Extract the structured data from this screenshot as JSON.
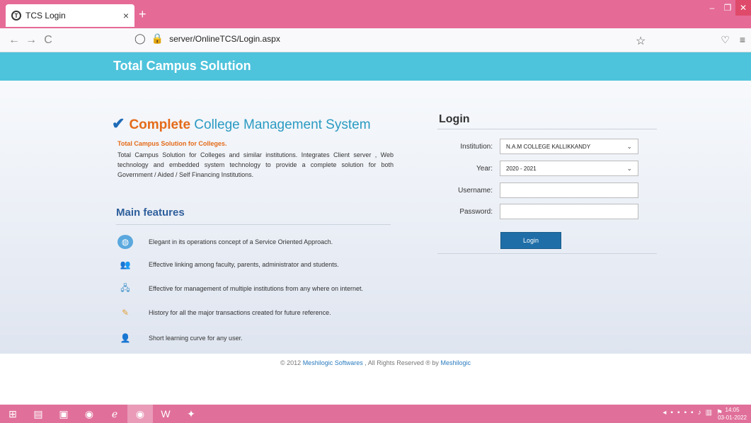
{
  "browser": {
    "tab_title": "TCS Login",
    "tab_close": "×",
    "new_tab": "+",
    "url": "server/OnlineTCS/Login.aspx",
    "back": "←",
    "forward": "→",
    "reload": "C"
  },
  "banner": {
    "title": "Total Campus Solution"
  },
  "intro": {
    "title_bold": "Complete",
    "title_rest": "College Management System",
    "sub_heading": "Total Campus Solution for Colleges.",
    "description": "Total Campus Solution for Colleges and similar institutions. Integrates Client server , Web technology and embedded system technology to provide a complete solution for both Government / Aided / Self Financing Institutions."
  },
  "features": {
    "title": "Main features",
    "items": [
      {
        "text": "Elegant in its operations concept of a Service Oriented Approach.",
        "icon": "globe-icon",
        "color": "#5aa8de"
      },
      {
        "text": "Effective linking among faculty, parents, administrator and students.",
        "icon": "people-icon",
        "color": "#d9823b"
      },
      {
        "text": "Effective for management of multiple institutions from any where on internet.",
        "icon": "network-icon",
        "color": "#3b8fc9"
      },
      {
        "text": "History for all the major transactions created for future reference.",
        "icon": "pencil-icon",
        "color": "#e0a23a"
      },
      {
        "text": "Short learning curve for any user.",
        "icon": "user-icon",
        "color": "#c98a4a"
      }
    ]
  },
  "login": {
    "title": "Login",
    "institution_label": "Institution:",
    "institution_value": "N.A.M COLLEGE KALLIKKANDY",
    "year_label": "Year:",
    "year_value": "2020 - 2021",
    "username_label": "Username:",
    "username_value": "",
    "password_label": "Password:",
    "password_value": "",
    "button": "Login"
  },
  "footer": {
    "copyright": "© 2012",
    "company": "Meshilogic Softwares",
    "rights": ", All Rights Reserved ® by",
    "brand": "Meshilogic"
  },
  "taskbar": {
    "time": "14:05",
    "date": "03-01-2022"
  }
}
